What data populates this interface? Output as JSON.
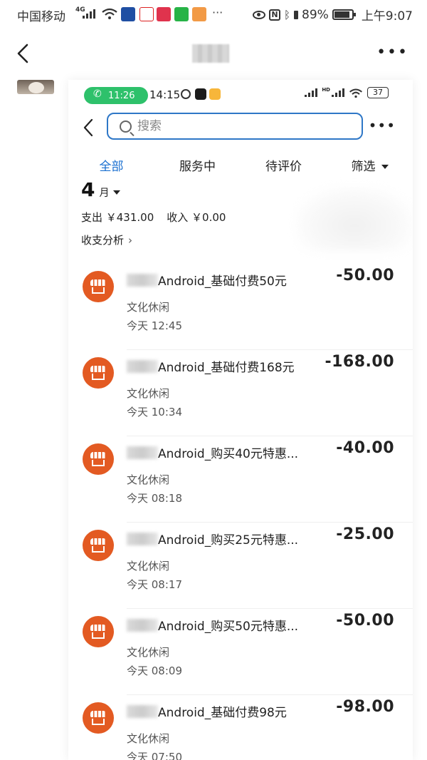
{
  "status_bar": {
    "carrier": "中国移动",
    "network": "4G",
    "battery": "89%",
    "time": "上午9:07",
    "more": "···"
  },
  "outer_header": {
    "more": "•••"
  },
  "inner": {
    "status": {
      "call_time": "11:26",
      "time": "14:15",
      "signal_label": "HD",
      "battery": "37"
    },
    "search": {
      "placeholder": "搜索",
      "more": "•••"
    },
    "tabs": [
      {
        "label": "全部",
        "active": true
      },
      {
        "label": "服务中"
      },
      {
        "label": "待评价"
      },
      {
        "label": "筛选"
      }
    ],
    "month": {
      "number": "4",
      "label": "月"
    },
    "summary": {
      "expense": "支出 ￥431.00",
      "income": "收入 ￥0.00"
    },
    "analysis_label": "收支分析",
    "analysis_chevron": "›",
    "transactions": [
      {
        "title": "Android_基础付费50元",
        "category": "文化休闲",
        "time": "今天  12:45",
        "amount": "-50.00"
      },
      {
        "title": "Android_基础付费168元",
        "category": "文化休闲",
        "time": "今天  10:34",
        "amount": "-168.00"
      },
      {
        "title": "Android_购买40元特惠...",
        "category": "文化休闲",
        "time": "今天  08:18",
        "amount": "-40.00"
      },
      {
        "title": "Android_购买25元特惠...",
        "category": "文化休闲",
        "time": "今天  08:17",
        "amount": "-25.00"
      },
      {
        "title": "Android_购买50元特惠...",
        "category": "文化休闲",
        "time": "今天  08:09",
        "amount": "-50.00"
      },
      {
        "title": "Android_基础付费98元",
        "category": "文化休闲",
        "time": "今天  07:50",
        "amount": "-98.00"
      }
    ]
  },
  "colors": {
    "accent_blue": "#1a6fd0",
    "search_border": "#2e77c7",
    "merchant_orange": "#e35a22",
    "call_green": "#2ec16b"
  }
}
